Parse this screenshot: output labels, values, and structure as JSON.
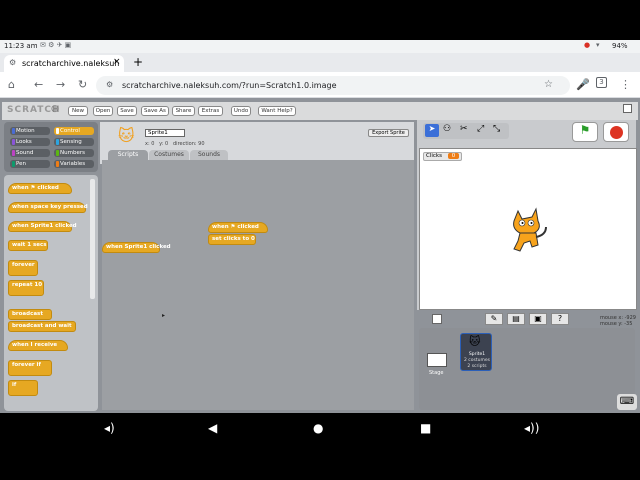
{
  "status": {
    "time": "11:23 am",
    "battery": "94%"
  },
  "browser": {
    "tab_title": "scratcharchive.naleksuh",
    "tab_close": "×",
    "new_tab": "+",
    "url": "scratcharchive.naleksuh.com/?run=Scratch1.0.image",
    "tab_count": "3"
  },
  "scratch": {
    "logo": "SCRATCH",
    "menu": [
      "New",
      "Open",
      "Save",
      "Save As",
      "Share",
      "Extras",
      "Undo",
      "Want Help?"
    ],
    "categories": [
      {
        "label": "Motion",
        "color": "#4a6cd4"
      },
      {
        "label": "Control",
        "color": "#e6a822"
      },
      {
        "label": "Looks",
        "color": "#8a55d7"
      },
      {
        "label": "Sensing",
        "color": "#2ca5e2"
      },
      {
        "label": "Sound",
        "color": "#bb42c3"
      },
      {
        "label": "Numbers",
        "color": "#5cb712"
      },
      {
        "label": "Pen",
        "color": "#0e9a6c"
      },
      {
        "label": "Variables",
        "color": "#ee7d16"
      }
    ],
    "palette_blocks": [
      {
        "label": "when ⚑ clicked",
        "hat": true
      },
      {
        "label": "when space key pressed",
        "hat": true
      },
      {
        "label": "when Sprite1 clicked",
        "hat": true
      },
      {
        "label": "wait 1 secs",
        "hat": false
      },
      {
        "label": "forever",
        "hat": false
      },
      {
        "label": "repeat 10",
        "hat": false
      },
      {
        "label": "broadcast",
        "hat": false
      },
      {
        "label": "broadcast and wait",
        "hat": false
      },
      {
        "label": "when I receive",
        "hat": true
      },
      {
        "label": "forever if",
        "hat": false
      },
      {
        "label": "if",
        "hat": false
      }
    ],
    "sprite_name": "Sprite1",
    "sprite_coords": "x: 0   y: 0   direction: 90",
    "export_sprite": "Export Sprite",
    "tabs": [
      "Scripts",
      "Costumes",
      "Sounds"
    ],
    "scripts": {
      "hat1": "when ⚑ clicked",
      "cmd1": "set clicks to 0",
      "hat2": "when Sprite1 clicked"
    },
    "monitor_label": "Clicks",
    "monitor_value": "0",
    "mouse_x": "mouse x: -929",
    "mouse_y": "mouse y: -35",
    "stage_label": "Stage",
    "sprite_tile": {
      "name": "Sprite1",
      "costumes": "2 costumes",
      "scripts": "2 scripts"
    }
  }
}
